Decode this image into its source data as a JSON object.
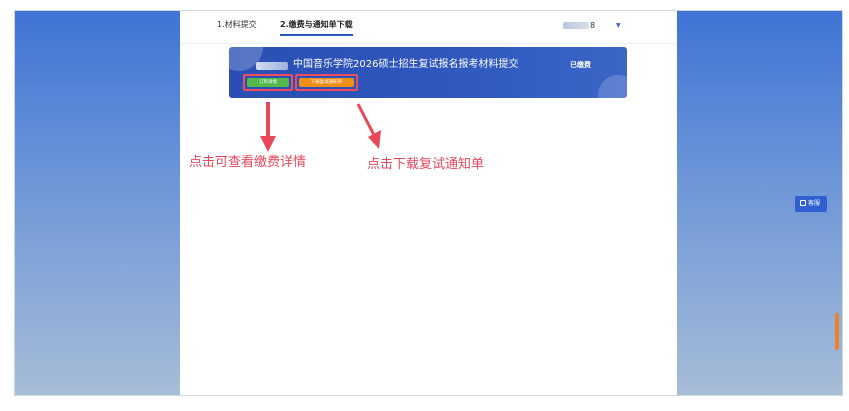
{
  "tabs": [
    {
      "label": "1.材料提交"
    },
    {
      "label": "2.缴费与通知单下载"
    }
  ],
  "user": {
    "id_suffix": "8",
    "caret": "▼"
  },
  "banner": {
    "title": "中国音乐学院2026硕士招生复试报名报考材料提交",
    "status": "已缴费",
    "order_button": "订单详情",
    "download_button": "下载复试通知单"
  },
  "annotations": {
    "left": "点击可查看缴费详情",
    "right": "点击下载复试通知单"
  },
  "service": {
    "label": "客服"
  },
  "colors": {
    "accent": "#2b58c8",
    "banner": "#2f57bd",
    "green": "#54b84b",
    "orange": "#f08f18",
    "annotation": "#e9475a"
  }
}
